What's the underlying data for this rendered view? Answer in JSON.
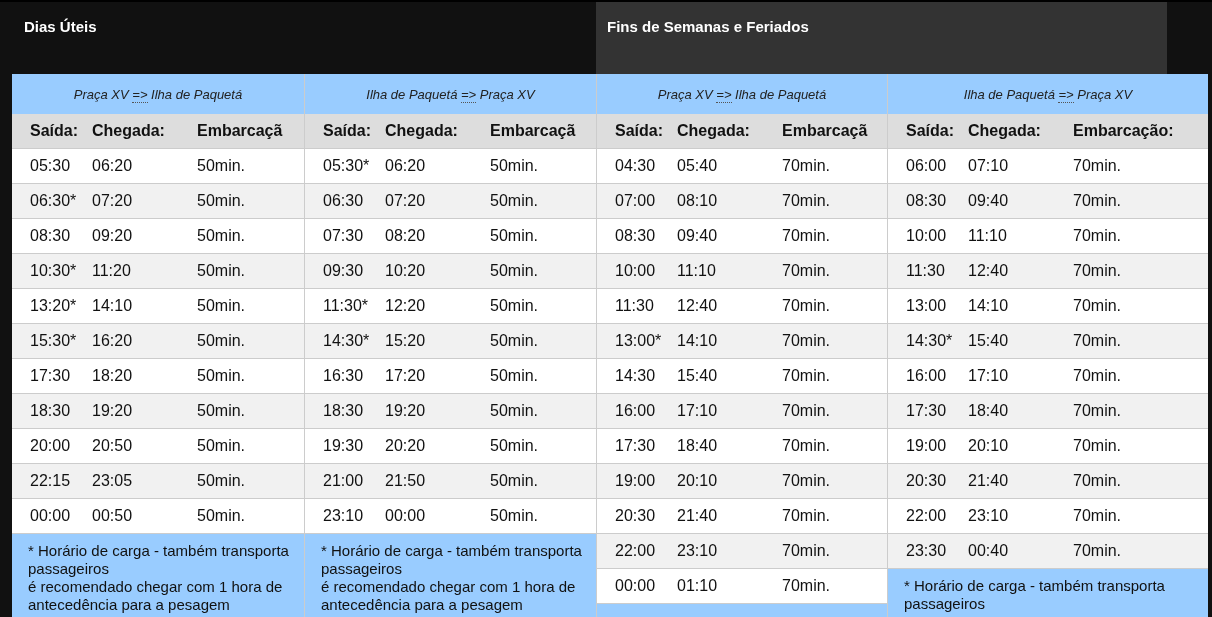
{
  "tabs": [
    {
      "label": "Dias Úteis",
      "selected": true
    },
    {
      "label": "Fins de Semanas e Feriados",
      "selected": false
    }
  ],
  "timetables": [
    {
      "route": {
        "from": "Praça XV",
        "arrow": "=>",
        "to": "Ilha de Paquetá"
      },
      "columns": [
        "Saída:",
        "Chegada:",
        "Embarcaçã"
      ],
      "rows": [
        [
          "05:30",
          "06:20",
          "50min."
        ],
        [
          "06:30*",
          "07:20",
          "50min."
        ],
        [
          "08:30",
          "09:20",
          "50min."
        ],
        [
          "10:30*",
          "11:20",
          "50min."
        ],
        [
          "13:20*",
          "14:10",
          "50min."
        ],
        [
          "15:30*",
          "16:20",
          "50min."
        ],
        [
          "17:30",
          "18:20",
          "50min."
        ],
        [
          "18:30",
          "19:20",
          "50min."
        ],
        [
          "20:00",
          "20:50",
          "50min."
        ],
        [
          "22:15",
          "23:05",
          "50min."
        ],
        [
          "00:00",
          "00:50",
          "50min."
        ]
      ],
      "footnote": [
        "* Horário de carga - também transporta passageiros",
        "é recomendado chegar com 1 hora de antecedência para a pesagem"
      ]
    },
    {
      "route": {
        "from": "Ilha de Paquetá",
        "arrow": "=>",
        "to": "Praça XV"
      },
      "columns": [
        "Saída:",
        "Chegada:",
        "Embarcaçã"
      ],
      "rows": [
        [
          "05:30*",
          "06:20",
          "50min."
        ],
        [
          "06:30",
          "07:20",
          "50min."
        ],
        [
          "07:30",
          "08:20",
          "50min."
        ],
        [
          "09:30",
          "10:20",
          "50min."
        ],
        [
          "11:30*",
          "12:20",
          "50min."
        ],
        [
          "14:30*",
          "15:20",
          "50min."
        ],
        [
          "16:30",
          "17:20",
          "50min."
        ],
        [
          "18:30",
          "19:20",
          "50min."
        ],
        [
          "19:30",
          "20:20",
          "50min."
        ],
        [
          "21:00",
          "21:50",
          "50min."
        ],
        [
          "23:10",
          "00:00",
          "50min."
        ]
      ],
      "footnote": [
        "* Horário de carga - também transporta passageiros",
        "é recomendado chegar com 1 hora de antecedência para a pesagem"
      ]
    },
    {
      "route": {
        "from": "Praça XV",
        "arrow": "=>",
        "to": "Ilha de Paquetá"
      },
      "columns": [
        "Saída:",
        "Chegada:",
        "Embarcaçã"
      ],
      "rows": [
        [
          "04:30",
          "05:40",
          "70min."
        ],
        [
          "07:00",
          "08:10",
          "70min."
        ],
        [
          "08:30",
          "09:40",
          "70min."
        ],
        [
          "10:00",
          "11:10",
          "70min."
        ],
        [
          "11:30",
          "12:40",
          "70min."
        ],
        [
          "13:00*",
          "14:10",
          "70min."
        ],
        [
          "14:30",
          "15:40",
          "70min."
        ],
        [
          "16:00",
          "17:10",
          "70min."
        ],
        [
          "17:30",
          "18:40",
          "70min."
        ],
        [
          "19:00",
          "20:10",
          "70min."
        ],
        [
          "20:30",
          "21:40",
          "70min."
        ],
        [
          "22:00",
          "23:10",
          "70min."
        ],
        [
          "00:00",
          "01:10",
          "70min."
        ]
      ]
    },
    {
      "route": {
        "from": "Ilha de Paquetá",
        "arrow": "=>",
        "to": "Praça XV"
      },
      "columns": [
        "Saída:",
        "Chegada:",
        "Embarcação:"
      ],
      "rows": [
        [
          "06:00",
          "07:10",
          "70min."
        ],
        [
          "08:30",
          "09:40",
          "70min."
        ],
        [
          "10:00",
          "11:10",
          "70min."
        ],
        [
          "11:30",
          "12:40",
          "70min."
        ],
        [
          "13:00",
          "14:10",
          "70min."
        ],
        [
          "14:30*",
          "15:40",
          "70min."
        ],
        [
          "16:00",
          "17:10",
          "70min."
        ],
        [
          "17:30",
          "18:40",
          "70min."
        ],
        [
          "19:00",
          "20:10",
          "70min."
        ],
        [
          "20:30",
          "21:40",
          "70min."
        ],
        [
          "22:00",
          "23:10",
          "70min."
        ],
        [
          "23:30",
          "00:40",
          "70min."
        ]
      ],
      "footnote": [
        "* Horário de carga - também transporta passageiros"
      ]
    }
  ]
}
